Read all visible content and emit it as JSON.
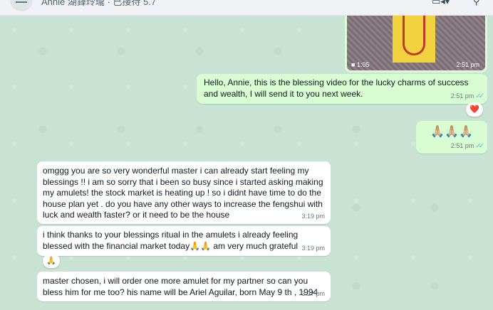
{
  "header": {
    "title": "Annie 湖鋒玲瓏 · 已接待 5.7",
    "video_call_icon": "video-camera-icon",
    "search_icon": "search-icon"
  },
  "video_message": {
    "duration": "1:05",
    "time": "2:51 pm"
  },
  "messages": [
    {
      "id": "m1",
      "direction": "out",
      "text": "Hello, Annie, this is the blessing video for the lucky charms of success and wealth, I will send it to you next week.",
      "time": "2:51 pm",
      "status": "read",
      "reaction": "❤️"
    },
    {
      "id": "m2",
      "direction": "out",
      "text": "🙏🏼🙏🏼🙏🏼",
      "time": "2:51 pm",
      "status": "read"
    },
    {
      "id": "m3",
      "direction": "in",
      "text": "omggg you are so very wonderful master i can already start feeling my blessings !! i am so sorry that i been so busy since i started asking making my amulets! the stock market is heating up ! so i didnt have time to do the house plan yet . do you have any other ways to increase the fengshui with luck and wealth faster? or it need to be the house",
      "time": "3:19 pm"
    },
    {
      "id": "m4",
      "direction": "in",
      "text": "i think thanks to your blessings ritual in the amulets i already feeling blessed with the financial market today🙏🙏 am very much grateful",
      "time": "3:19 pm",
      "reaction": "🙏"
    },
    {
      "id": "m5",
      "direction": "in",
      "text": "master chosen, i will order one more amulet for my partner so can you bless him for me too? his name will be Ariel Aguilar, born May 9 th , 1994",
      "time": "3:27 pm"
    }
  ],
  "read_ticks": "✓✓",
  "colors": {
    "chat_bg": "#c8e3d4",
    "outgoing": "#d9fdd3",
    "incoming": "#ffffff",
    "read_tick": "#53bdeb"
  }
}
